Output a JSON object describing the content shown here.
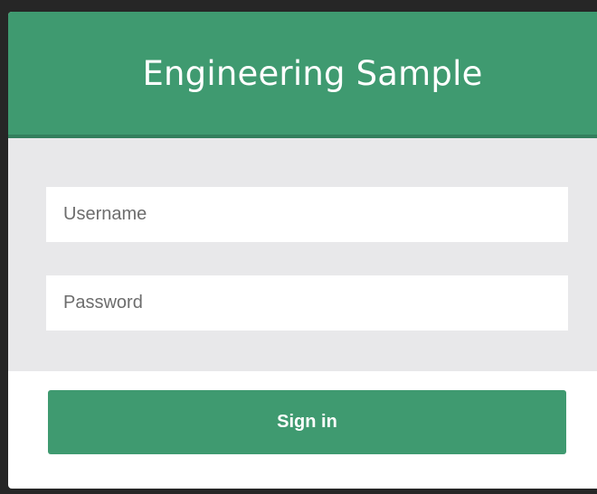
{
  "header": {
    "title": "Engineering Sample"
  },
  "form": {
    "username_placeholder": "Username",
    "username_value": "",
    "password_placeholder": "Password",
    "password_value": "",
    "submit_label": "Sign in"
  },
  "colors": {
    "brand_green": "#3f9a70",
    "form_background": "#e8e8ea",
    "window_background": "#262626"
  }
}
